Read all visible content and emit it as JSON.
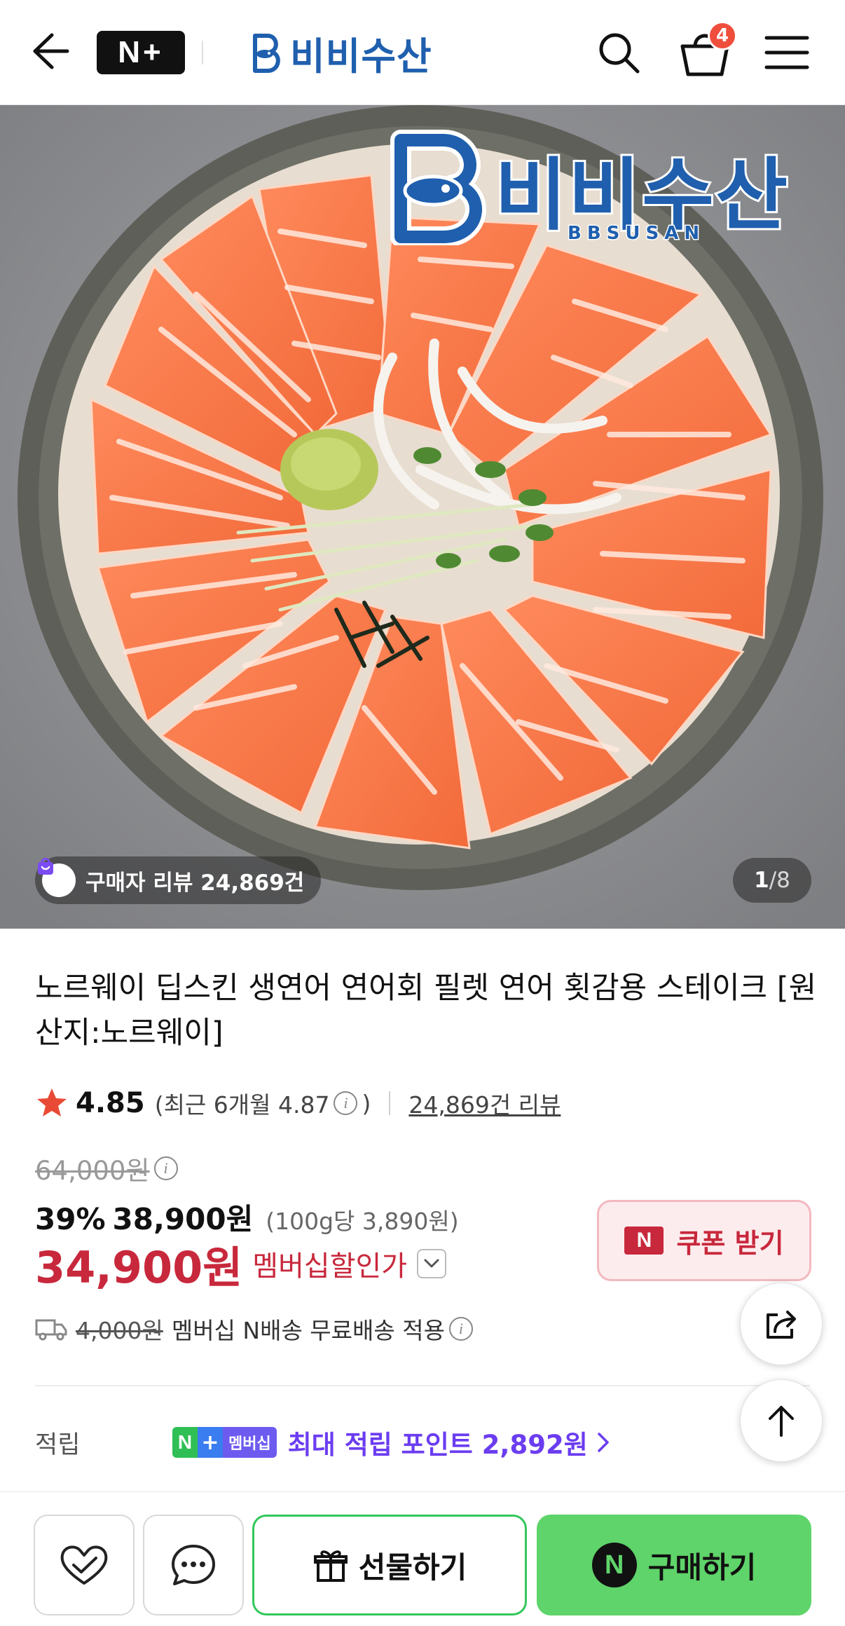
{
  "header": {
    "nplus_logo": "N+",
    "brand": "비비수산",
    "cart_count": "4"
  },
  "hero": {
    "logo_text": "비비수산",
    "logo_sub": "BBSUSAN",
    "review_badge": "구매자 리뷰 24,869건",
    "page_current": "1",
    "page_sep": "/",
    "page_total": "8"
  },
  "product": {
    "title": "노르웨이 딥스킨 생연어 연어회 필렛 연어 횟감용 스테이크 [원산지:노르웨이]",
    "rating": "4.85",
    "recent_rating_prefix": "(최근 6개월 4.87",
    "recent_rating_suffix": ")",
    "info_icon": "i",
    "review_link": "24,869건 리뷰",
    "original_price": "64,000원",
    "discount_pct": "39%",
    "discount_price": "38,900원",
    "unit_price": "(100g당 3,890원)",
    "member_price": "34,900원",
    "member_label": "멤버십할인가",
    "coupon_n": "N",
    "coupon_label": "쿠폰 받기",
    "ship_original": "4,000원",
    "ship_text": "멤버십 N배송 무료배송 적용",
    "points_label": "적립",
    "points_badge_n": "N",
    "points_badge_plus": "+",
    "points_badge_mem": "멤버십",
    "points_text": "최대 적립 포인트 2,892원"
  },
  "bottom": {
    "gift_label": "선물하기",
    "buy_n": "N",
    "buy_label": "구매하기"
  },
  "colors": {
    "brand_blue": "#1f5fae",
    "sale_red": "#c8283c",
    "naver_green": "#5fd46a",
    "points_purple": "#6b3df0",
    "badge_red": "#f04e3c"
  }
}
